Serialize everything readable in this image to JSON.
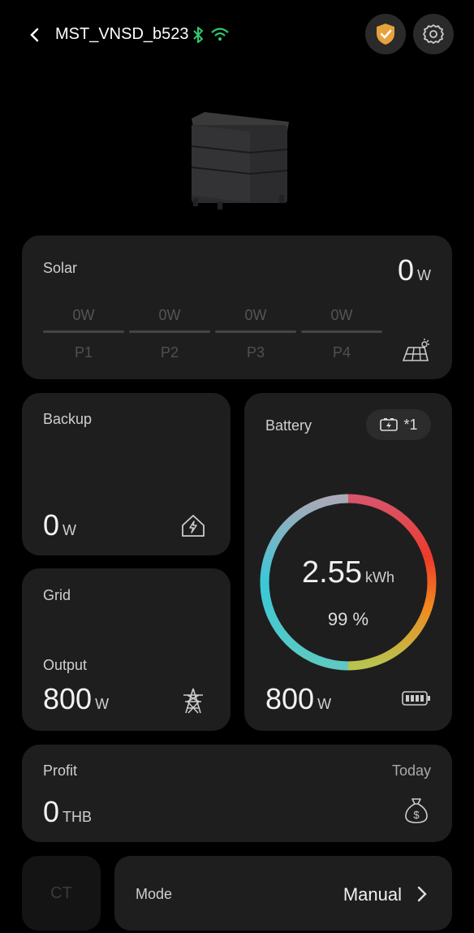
{
  "header": {
    "device_name": "MST_VNSD_b523"
  },
  "solar": {
    "title": "Solar",
    "value": "0",
    "unit": "W",
    "panels": [
      {
        "label": "P1",
        "value": "0W"
      },
      {
        "label": "P2",
        "value": "0W"
      },
      {
        "label": "P3",
        "value": "0W"
      },
      {
        "label": "P4",
        "value": "0W"
      }
    ]
  },
  "backup": {
    "title": "Backup",
    "value": "0",
    "unit": "W"
  },
  "grid": {
    "title": "Grid",
    "sublabel": "Output",
    "value": "800",
    "unit": "W"
  },
  "battery": {
    "title": "Battery",
    "pack_count": "*1",
    "energy": "2.55",
    "energy_unit": "kWh",
    "percent": "99 %",
    "percent_value": 99,
    "power": "800",
    "power_unit": "W"
  },
  "profit": {
    "title": "Profit",
    "period": "Today",
    "value": "0",
    "unit": "THB"
  },
  "ct": {
    "label": "CT"
  },
  "mode": {
    "label": "Mode",
    "value": "Manual"
  },
  "colors": {
    "background": "#000000",
    "card": "#1e1e1e",
    "status_green": "#2ecc71",
    "shield_orange": "#e6a23c"
  }
}
